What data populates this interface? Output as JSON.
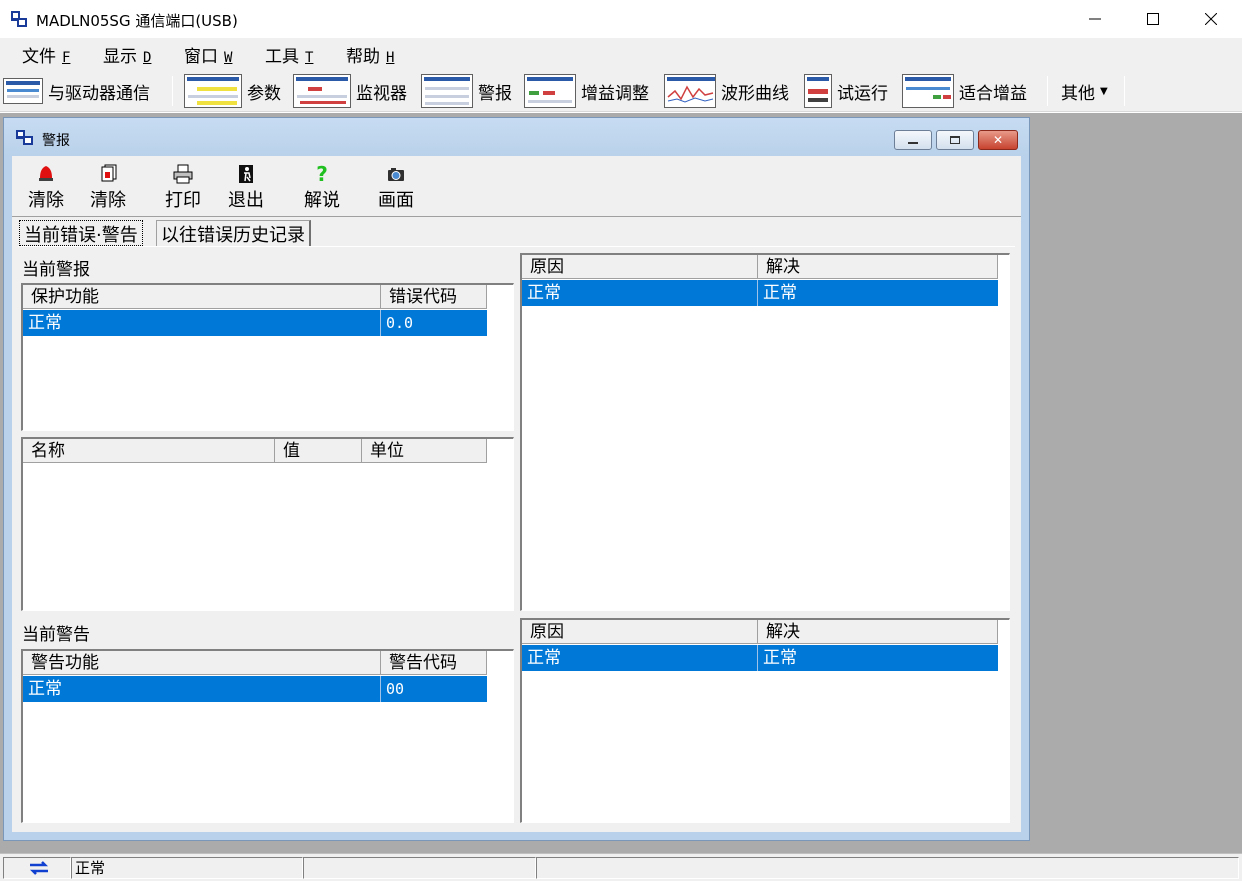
{
  "window": {
    "title": "MADLN05SG  通信端口(USB)",
    "minimize_icon": "minimize-icon",
    "maximize_icon": "maximize-icon",
    "close_icon": "close-icon"
  },
  "menubar": {
    "items": [
      {
        "label": "文件",
        "key": "F"
      },
      {
        "label": "显示",
        "key": "D"
      },
      {
        "label": "窗口",
        "key": "W"
      },
      {
        "label": "工具",
        "key": "T"
      },
      {
        "label": "帮助",
        "key": "H"
      }
    ]
  },
  "toolbar": {
    "items": [
      {
        "label": "与驱动器通信",
        "icon": "communicate-icon"
      },
      {
        "label": "参数",
        "icon": "parameter-icon"
      },
      {
        "label": "监视器",
        "icon": "monitor-icon"
      },
      {
        "label": "警报",
        "icon": "alarm-icon"
      },
      {
        "label": "增益调整",
        "icon": "gain-tuning-icon"
      },
      {
        "label": "波形曲线",
        "icon": "waveform-icon"
      },
      {
        "label": "试运行",
        "icon": "trial-run-icon"
      },
      {
        "label": "适合增益",
        "icon": "fit-gain-icon"
      }
    ],
    "more": {
      "label": "其他",
      "icon": "dropdown-arrow-icon"
    }
  },
  "child_window": {
    "title": "警报",
    "toolbar": [
      {
        "label": "清除",
        "icon": "alarm-bell-icon"
      },
      {
        "label": "清除",
        "icon": "clear-history-icon"
      },
      {
        "label": "打印",
        "icon": "printer-icon"
      },
      {
        "label": "退出",
        "icon": "exit-icon"
      },
      {
        "label": "解说",
        "icon": "help-question-icon"
      },
      {
        "label": "画面",
        "icon": "camera-icon"
      }
    ],
    "tabs": [
      {
        "label": "当前错误·警告",
        "active": true
      },
      {
        "label": "以往错误历史记录",
        "active": false
      }
    ],
    "current_alarm": {
      "label": "当前警报",
      "columns": [
        "保护功能",
        "错误代码"
      ],
      "rows": [
        [
          "正常",
          "0.0"
        ]
      ],
      "detail_columns": [
        "名称",
        "值",
        "单位"
      ],
      "cause_columns": [
        "原因",
        "解决"
      ],
      "cause_rows": [
        [
          "正常",
          "正常"
        ]
      ]
    },
    "current_warning": {
      "label": "当前警告",
      "columns": [
        "警告功能",
        "警告代码"
      ],
      "rows": [
        [
          "正常",
          "00"
        ]
      ],
      "cause_columns": [
        "原因",
        "解决"
      ],
      "cause_rows": [
        [
          "正常",
          "正常"
        ]
      ]
    }
  },
  "statusbar": {
    "connection_icon": "connection-arrows-icon",
    "status": "正常"
  },
  "colors": {
    "selection": "#0078d7",
    "mdi_background": "#ababab",
    "child_frame": "#b9d1ea"
  }
}
